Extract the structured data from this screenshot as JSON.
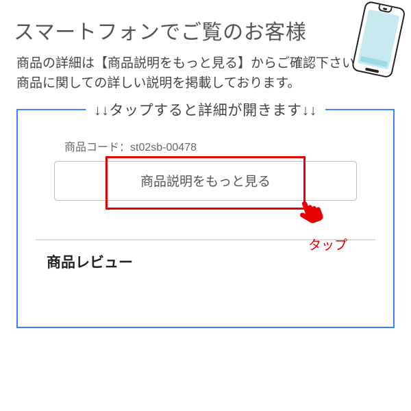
{
  "header": {
    "title": "スマートフォンでご覧のお客様"
  },
  "description": {
    "line1": "商品の詳細は【商品説明をもっと見る】からご確認下さい。",
    "line2": "商品に関しての詳しい説明を掲載しております。"
  },
  "instruction_box": {
    "legend": "↓↓タップすると詳細が開きます↓↓",
    "product_code_label": "商品コード：",
    "product_code_value": "st02sb-00478",
    "more_button_label": "商品説明をもっと見る",
    "tap_label": "タップ",
    "review_heading": "商品レビュー"
  }
}
